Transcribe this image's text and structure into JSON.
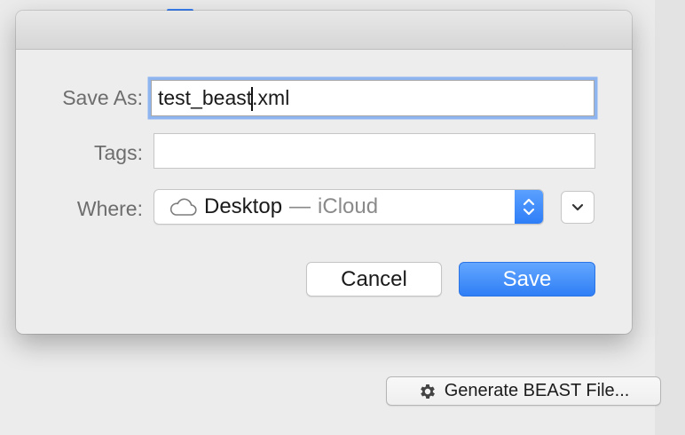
{
  "dialog": {
    "save_as_label": "Save As:",
    "filename_before_caret": "test_beast",
    "filename_after_caret": ".xml",
    "tags_label": "Tags:",
    "tags_value": "",
    "where_label": "Where:",
    "where_location": "Desktop",
    "where_separator": "—",
    "where_service": "iCloud",
    "cancel_label": "Cancel",
    "save_label": "Save",
    "accent_color": "#2f7ef5",
    "location_icon": "cloud-icon"
  },
  "background": {
    "generate_button_label": "Generate BEAST File...",
    "generate_button_icon": "gear-icon"
  }
}
